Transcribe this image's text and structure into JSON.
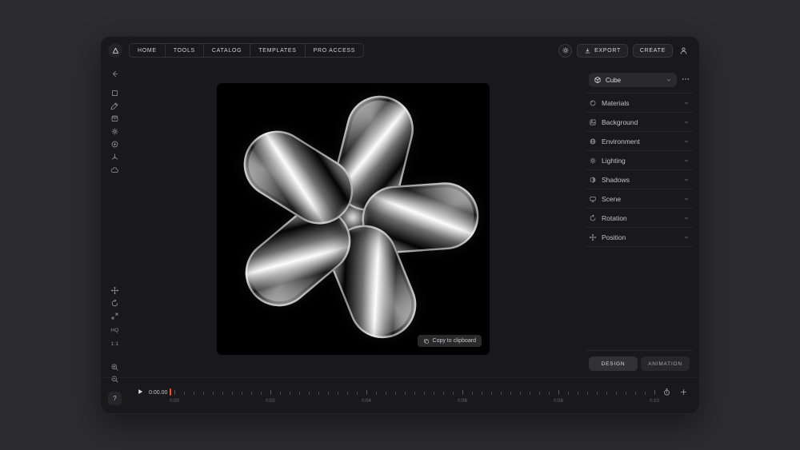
{
  "topbar": {
    "nav": [
      "HOME",
      "TOOLS",
      "CATALOG",
      "TEMPLATES",
      "PRO ACCESS"
    ],
    "export_label": "EXPORT",
    "create_label": "CREATE"
  },
  "left_toolbar": {
    "hq_label": "HQ",
    "ratio_label": "1:1",
    "help_label": "?"
  },
  "canvas": {
    "copy_to_clipboard_label": "Copy to clipboard"
  },
  "right_panel": {
    "object_selector": {
      "value": "Cube"
    },
    "sections": [
      {
        "label": "Materials",
        "icon": "materials-icon"
      },
      {
        "label": "Background",
        "icon": "background-icon"
      },
      {
        "label": "Environment",
        "icon": "environment-icon"
      },
      {
        "label": "Lighting",
        "icon": "lighting-icon"
      },
      {
        "label": "Shadows",
        "icon": "shadows-icon"
      },
      {
        "label": "Scene",
        "icon": "scene-icon"
      },
      {
        "label": "Rotation",
        "icon": "rotation-icon"
      },
      {
        "label": "Position",
        "icon": "position-icon"
      }
    ],
    "tabs": [
      {
        "label": "DESIGN",
        "active": true
      },
      {
        "label": "ANIMATION",
        "active": false
      }
    ]
  },
  "timeline": {
    "current_time": "0:00.00",
    "tick_labels": [
      "0:00",
      "0:02",
      "0:04",
      "0:06",
      "0:08",
      "0:10"
    ]
  },
  "icons": {
    "logo-icon": "triangle",
    "theme-icon": "sun",
    "download-icon": "arrow-down",
    "user-icon": "person",
    "back-icon": "arrow-left",
    "copy-icon": "copy",
    "play-icon": "triangle-right",
    "stopwatch-icon": "stopwatch",
    "add-keyframe-icon": "plus"
  },
  "colors": {
    "accent": "#ff4a1f",
    "window_bg": "#19191b",
    "canvas_bg": "#000000",
    "panel_row_bg": "#2a2a2e"
  }
}
